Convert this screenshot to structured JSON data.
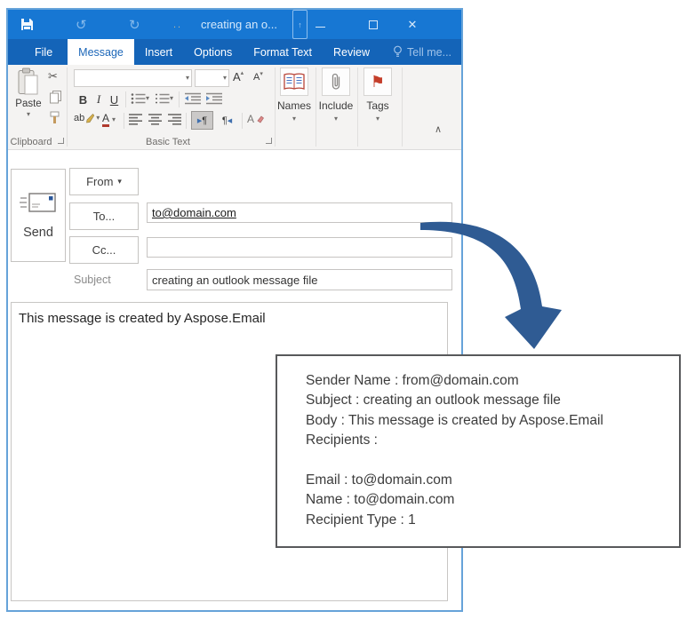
{
  "colors": {
    "titlebar_blue": "#1777d3",
    "tabrow_blue": "#1464b8",
    "active_tab_text": "#1b66b8",
    "window_border_blue": "#66a3d9",
    "arrow_blue": "#2f5b93",
    "flag_red": "#c43e2a",
    "callout_border": "#58595b"
  },
  "titlebar": {
    "title": "creating an o...",
    "dots": ".."
  },
  "tabs": {
    "file": "File",
    "message": "Message",
    "insert": "Insert",
    "options": "Options",
    "format_text": "Format Text",
    "review": "Review",
    "tell_me": "Tell me..."
  },
  "ribbon": {
    "paste": "Paste",
    "clipboard_group": "Clipboard",
    "basic_text_group": "Basic Text",
    "names": "Names",
    "include": "Include",
    "tags": "Tags",
    "bold": "B",
    "italic": "I",
    "underline": "U",
    "grow_font": "A",
    "shrink_font": "A",
    "highlight": "ab",
    "font_color": "A",
    "clear_format": "A",
    "pilcrow_ltr": "¶",
    "pilcrow_rtl": "¶"
  },
  "glyphs": {
    "dropdown": "▾",
    "up_caret": "▴",
    "undo": "↺",
    "redo": "↻",
    "close": "✕",
    "scissors": "✂",
    "flag": "⚑",
    "collapse": "∧",
    "ltr_marker": "▶",
    "rtl_marker": "◀",
    "popout_arrow": "↑"
  },
  "compose": {
    "send": "Send",
    "from": "From",
    "to": "To...",
    "cc": "Cc...",
    "subject_label": "Subject",
    "to_value": "to@domain.com",
    "cc_value": "",
    "subject_value": "creating an outlook message file",
    "body": "This message is created by Aspose.Email"
  },
  "callout": {
    "lines": [
      "Sender Name : from@domain.com",
      "Subject : creating an outlook message file",
      "Body : This message is created by Aspose.Email",
      "Recipients :",
      "",
      "Email : to@domain.com",
      "Name : to@domain.com",
      "Recipient Type : 1"
    ]
  }
}
